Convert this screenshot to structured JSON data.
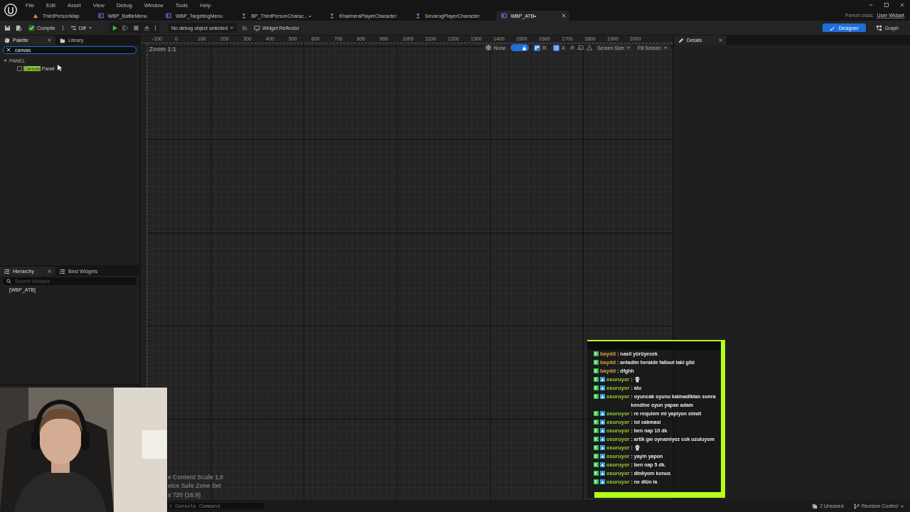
{
  "menu": [
    "File",
    "Edit",
    "Asset",
    "View",
    "Debug",
    "Window",
    "Tools",
    "Help"
  ],
  "tabs": [
    {
      "label": "ThirdPersonMap",
      "kind": "map",
      "selected": false
    },
    {
      "label": "WBP_BattleMenu",
      "kind": "widget",
      "selected": false
    },
    {
      "label": "WBP_TargetingMenu",
      "kind": "widget",
      "selected": false
    },
    {
      "label": "BP_ThirdPersonCharac... •",
      "kind": "character",
      "selected": false
    },
    {
      "label": "KhaimeraPlayerCharacter",
      "kind": "character",
      "selected": false
    },
    {
      "label": "SevarogPlayerCharacter",
      "kind": "character",
      "selected": false
    },
    {
      "label": "WBP_ATB•",
      "kind": "widget",
      "selected": true,
      "closable": true
    }
  ],
  "parent_class": {
    "label": "Parent class:",
    "value": "User Widget"
  },
  "toolbar": {
    "compile": "Compile",
    "diff": "Diff",
    "debug_object": "No debug object selected",
    "widget_reflector": "Widget Reflector"
  },
  "modes": [
    {
      "label": "Designer",
      "selected": true
    },
    {
      "label": "Graph",
      "selected": false
    }
  ],
  "palette": {
    "tabs": [
      {
        "label": "Palette",
        "selected": true
      },
      {
        "label": "Library",
        "selected": false
      }
    ],
    "search": {
      "value": "canvas"
    },
    "categories": [
      {
        "label": "PANEL",
        "expanded": true,
        "children": [
          {
            "match": "Canvas",
            "rest": " Panel"
          }
        ]
      }
    ]
  },
  "hierarchy": {
    "tabs": [
      {
        "label": "Hierarchy",
        "selected": true
      },
      {
        "label": "Bind Widgets",
        "selected": false
      }
    ],
    "search": {
      "placeholder": "Search Widgets"
    },
    "tree": [
      {
        "label": "[WBP_ATB]"
      }
    ]
  },
  "viewport": {
    "zoom": "Zoom 1:1",
    "ruler": [
      "-100",
      "0",
      "100",
      "200",
      "300",
      "400",
      "500",
      "600",
      "700",
      "800",
      "900",
      "1000",
      "1100",
      "1200",
      "1300",
      "1400",
      "1500",
      "1600",
      "1700",
      "1800",
      "1900",
      "2000"
    ],
    "toolbar": {
      "locale": "None",
      "respect_lock": true,
      "r": "R",
      "grid_on": true,
      "grid": "4",
      "screen_size": "Screen Size",
      "fill": "Fill Screen"
    },
    "info": [
      "e Content Scale 1,0",
      "vice Safe Zone Set",
      "x 720 (16:9)"
    ]
  },
  "details": {
    "title": "Details"
  },
  "chat": [
    {
      "user": "baydd",
      "color": "#d9a441",
      "subscriber": false,
      "text": ": nasil yürüyecek"
    },
    {
      "user": "baydd",
      "color": "#d9a441",
      "subscriber": false,
      "text": ": anladim heralde fallout taki gibi"
    },
    {
      "user": "baydd",
      "color": "#d9a441",
      "subscriber": false,
      "text": ": dfghh"
    },
    {
      "user": "osuruyor",
      "color": "#9acd32",
      "subscriber": true,
      "text": ":",
      "emote": true
    },
    {
      "user": "osuruyor",
      "color": "#9acd32",
      "subscriber": true,
      "text": ": alu"
    },
    {
      "user": "osuruyor",
      "color": "#9acd32",
      "subscriber": true,
      "text": ": oyuncak oyunu kalmadiktan sonra kendine oyun yapan adam"
    },
    {
      "user": "osuruyor",
      "color": "#9acd32",
      "subscriber": true,
      "text": ": re requiem mi yapiyon simdi"
    },
    {
      "user": "osuruyor",
      "color": "#9acd32",
      "subscriber": true,
      "text": ": lol cakmasi"
    },
    {
      "user": "osuruyor",
      "color": "#9acd32",
      "subscriber": true,
      "text": ": ben nap 10 dk"
    },
    {
      "user": "osuruyor",
      "color": "#9acd32",
      "subscriber": true,
      "text": ": artik gw oynamiyoz cok uzuluyom"
    },
    {
      "user": "osuruyor",
      "color": "#9acd32",
      "subscriber": true,
      "text": ":",
      "emote": true
    },
    {
      "user": "osuruyor",
      "color": "#9acd32",
      "subscriber": true,
      "text": ": yayin yapon"
    },
    {
      "user": "osuruyor",
      "color": "#9acd32",
      "subscriber": true,
      "text": ": ben nap 5 dk."
    },
    {
      "user": "osuruyor",
      "color": "#9acd32",
      "subscriber": true,
      "text": ": dinliyom konus"
    },
    {
      "user": "osuruyor",
      "color": "#9acd32",
      "subscriber": true,
      "text": ": ne diün la"
    }
  ],
  "status_bar": {
    "console": {
      "placeholder": "r Console Command"
    },
    "unsaved": "2 Unsaved",
    "revision": "Revision Control"
  }
}
